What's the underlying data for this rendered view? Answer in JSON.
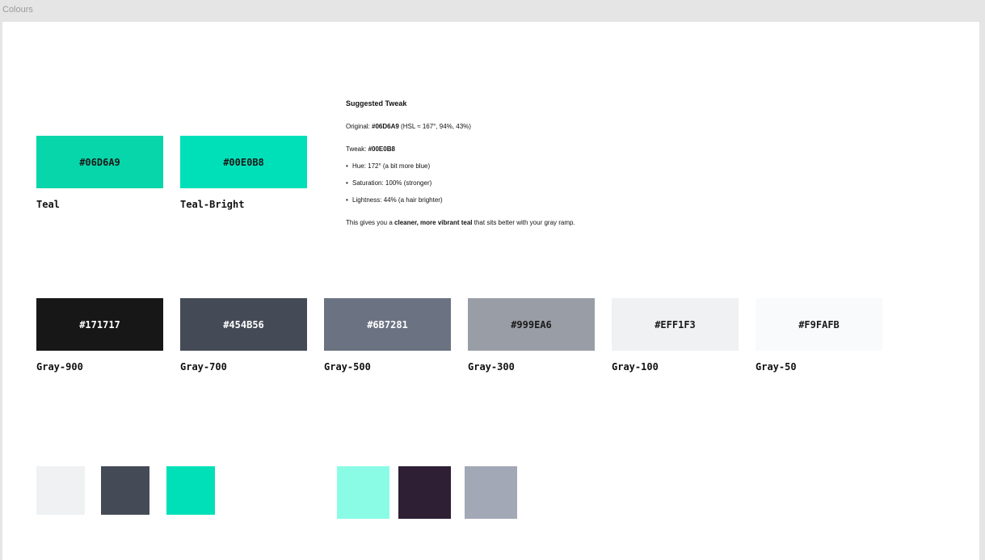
{
  "frame": {
    "label": "Colours"
  },
  "palette": {
    "teal": [
      {
        "name": "Teal",
        "hex": "#06D6A9",
        "color": "#06D6A9",
        "text_color": "#1a1a1a"
      },
      {
        "name": "Teal-Bright",
        "hex": "#00E0B8",
        "color": "#00E0B8",
        "text_color": "#1a1a1a"
      }
    ],
    "gray": [
      {
        "name": "Gray-900",
        "hex": "#171717",
        "color": "#171717",
        "text_color": "#ffffff"
      },
      {
        "name": "Gray-700",
        "hex": "#454B56",
        "color": "#454B56",
        "text_color": "#ffffff"
      },
      {
        "name": "Gray-500",
        "hex": "#6B7281",
        "color": "#6B7281",
        "text_color": "#ffffff"
      },
      {
        "name": "Gray-300",
        "hex": "#999EA6",
        "color": "#999EA6",
        "text_color": "#1a1a1a"
      },
      {
        "name": "Gray-100",
        "hex": "#EFF1F3",
        "color": "#EFF1F3",
        "text_color": "#1a1a1a"
      },
      {
        "name": "Gray-50",
        "hex": "#F9FAFB",
        "color": "#F9FAFB",
        "text_color": "#1a1a1a"
      }
    ]
  },
  "note": {
    "title": "Suggested Tweak",
    "original_prefix": "Original: ",
    "original_hex": "#06D6A9",
    "original_suffix": " (HSL ≈ 167°, 94%, 43%)",
    "tweak_prefix": "Tweak: ",
    "tweak_hex": "#00E0B8",
    "bullets": [
      "Hue: 172° (a bit more blue)",
      "Saturation: 100% (stronger)",
      "Lightness: 44% (a hair brighter)"
    ],
    "bullet_glyph": "•",
    "summary_prefix": "This gives you a ",
    "summary_bold": "cleaner, more vibrant teal",
    "summary_suffix": " that sits better with your gray ramp."
  },
  "chips": {
    "group_a": [
      "#EFF1F3",
      "#454B56",
      "#00E0B8"
    ],
    "group_b": [
      "#8AFCE6",
      "#2E1F35",
      "#A3A8B6"
    ]
  }
}
